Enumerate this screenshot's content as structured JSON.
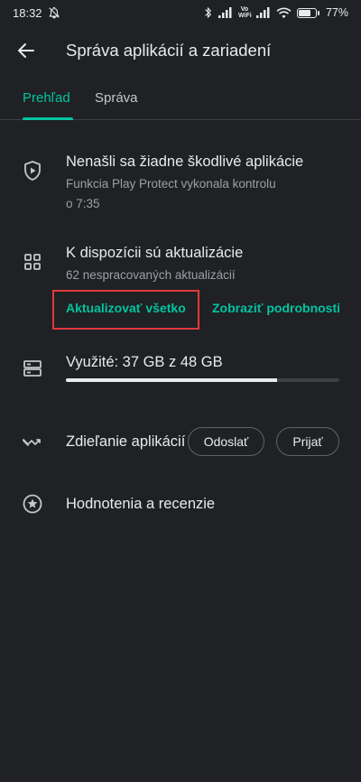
{
  "status_bar": {
    "time": "18:32",
    "network_label": "Vo WiFi",
    "battery": "77%",
    "battery_level": 0.77
  },
  "app_bar": {
    "title": "Správa aplikácií a zariadení"
  },
  "tabs": [
    {
      "label": "Prehľad",
      "active": true
    },
    {
      "label": "Správa",
      "active": false
    }
  ],
  "play_protect": {
    "title": "Nenašli sa žiadne škodlivé aplikácie",
    "subtitle_line1": "Funkcia Play Protect vykonala kontrolu",
    "subtitle_line2": "o 7:35"
  },
  "updates": {
    "title": "K dispozícii sú aktualizácie",
    "subtitle": "62 nespracovaných aktualizácií",
    "update_all_label": "Aktualizovať všetko",
    "details_label": "Zobraziť podrobnosti"
  },
  "storage": {
    "label": "Využité: 37 GB z 48 GB",
    "used_fraction": 0.771
  },
  "sharing": {
    "title": "Zdieľanie aplikácií",
    "send_label": "Odoslať",
    "receive_label": "Prijať"
  },
  "ratings": {
    "title": "Hodnotenia a recenzie"
  },
  "colors": {
    "background": "#202124",
    "accent": "#00c4a0",
    "highlight": "#e03a3e"
  }
}
